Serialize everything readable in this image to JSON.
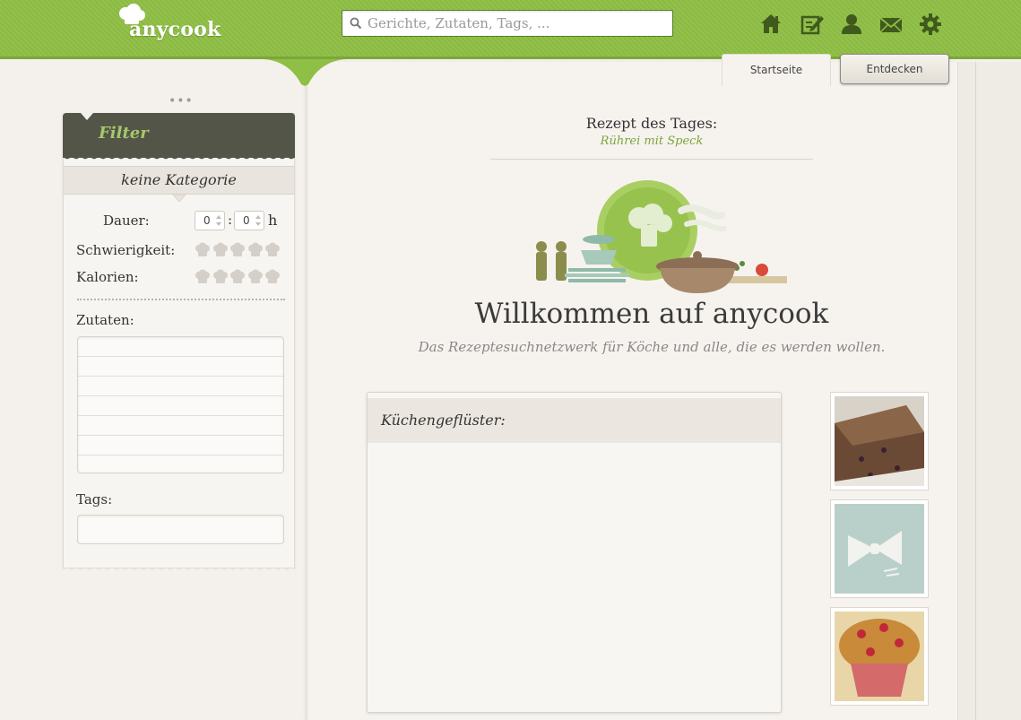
{
  "header": {
    "logo_text": "anycook",
    "search": {
      "placeholder": "Gerichte, Zutaten, Tags, ...",
      "value": ""
    },
    "nav_icons": [
      "home-icon",
      "edit-icon",
      "user-icon",
      "mail-icon",
      "gear-icon"
    ]
  },
  "tabs": [
    {
      "label": "Startseite",
      "active": true
    },
    {
      "label": "Entdecken",
      "active": false
    }
  ],
  "filter": {
    "title": "Filter",
    "category": "keine Kategorie",
    "duration": {
      "label": "Dauer:",
      "hours": "0",
      "minutes": "0",
      "unit": "h"
    },
    "difficulty": {
      "label": "Schwierigkeit:",
      "rating": 0,
      "max": 5
    },
    "calories": {
      "label": "Kalorien:",
      "rating": 0,
      "max": 5
    },
    "ingredients_label": "Zutaten:",
    "tags_label": "Tags:"
  },
  "main": {
    "recipe_of_day_label": "Rezept des Tages:",
    "recipe_of_day_name": "Rührei mit Speck",
    "welcome_title": "Willkommen auf anycook",
    "welcome_subtitle": "Das Rezeptesuchnetzwerk für Köche und alle, die es werden wollen.",
    "kitchen_whisper_title": "Küchengeflüster:",
    "thumbnails": [
      "cake-photo",
      "pasta-illustration",
      "muffin-photo"
    ]
  },
  "colors": {
    "header_green": "#8fbf45",
    "accent_green": "#7ca43c",
    "filter_dark": "#545549",
    "filter_title": "#a5c86a"
  }
}
